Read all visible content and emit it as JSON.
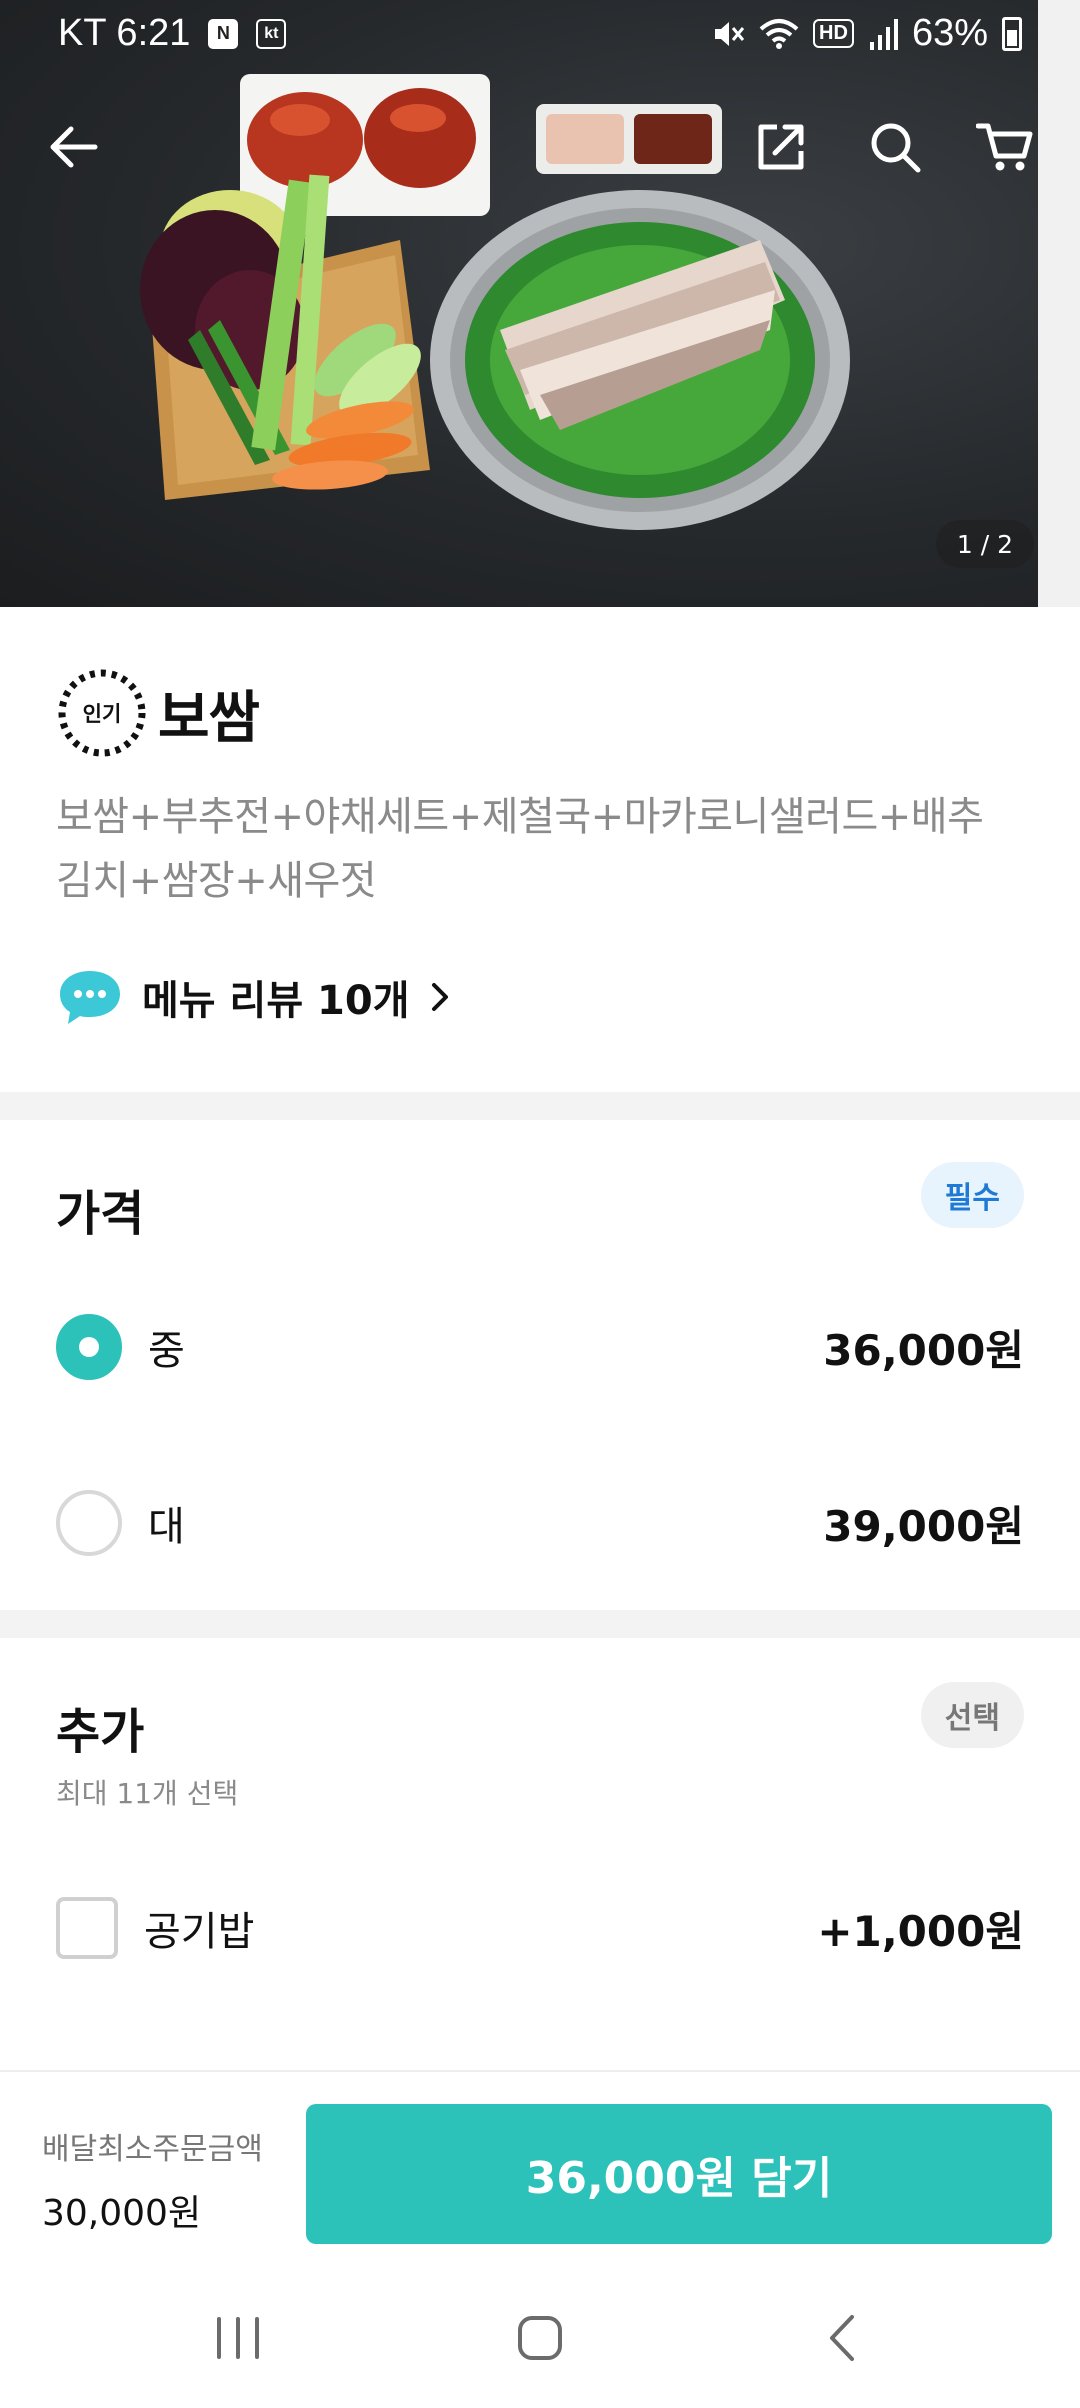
{
  "status_bar": {
    "carrier_time": "KT 6:21",
    "badge_n": "N",
    "badge_kt": "kt",
    "network": "HD",
    "battery": "63%"
  },
  "hero": {
    "page_indicator": "1 / 2",
    "icons": [
      "back-arrow-icon",
      "share-icon",
      "search-icon",
      "cart-icon"
    ]
  },
  "item": {
    "badge": "인기",
    "name": "보쌈",
    "description_line1": "보쌈+부추전+야채세트+제철국+마카로니샐러드+배추",
    "description_line2": "김치+쌈장+새우젓",
    "review_label": "메뉴 리뷰 10개"
  },
  "price_section": {
    "title": "가격",
    "tag": "필수",
    "options": [
      {
        "label": "중",
        "price": "36,000원",
        "selected": true
      },
      {
        "label": "대",
        "price": "39,000원",
        "selected": false
      }
    ]
  },
  "addon_section": {
    "title": "추가",
    "tag": "선택",
    "subtitle": "최대 11개 선택",
    "options": [
      {
        "label": "공기밥",
        "price": "+1,000원",
        "checked": false
      }
    ]
  },
  "bottom_bar": {
    "min_order_label": "배달최소주문금액",
    "min_order_value": "30,000원",
    "add_button": "36,000원 담기"
  },
  "colors": {
    "accent": "#2cc2ba",
    "required_tag": "#1f7ad6",
    "review_icon": "#3cc8d6"
  }
}
